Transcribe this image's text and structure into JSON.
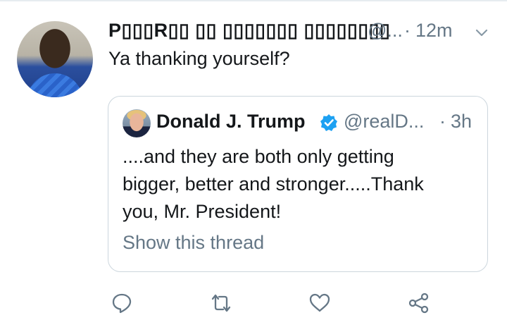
{
  "reply": {
    "display_name": "P▯▯▯R▯▯ ▯▯ ▯▯▯▯▯▯▯ ▯▯▯▯▯▯▯▯",
    "handle": "@...",
    "separator": "·",
    "time": "12m",
    "text": "Ya thanking yourself?",
    "menu_icon": "chevron-down-icon"
  },
  "quoted": {
    "display_name": "Donald J. Trump",
    "verified_icon": "verified-badge-icon",
    "handle": "@realD...",
    "separator": "·",
    "time": "3h",
    "lines": [
      "....and they are both only getting",
      "bigger, better and stronger.....Thank",
      "you, Mr. President!"
    ],
    "show_thread": "Show this thread"
  },
  "actions": [
    "reply-icon",
    "retweet-icon",
    "like-icon",
    "share-icon"
  ],
  "colors": {
    "text": "#14171a",
    "secondary": "#657786",
    "border": "#ccd6dd",
    "verified": "#1da1f2"
  }
}
